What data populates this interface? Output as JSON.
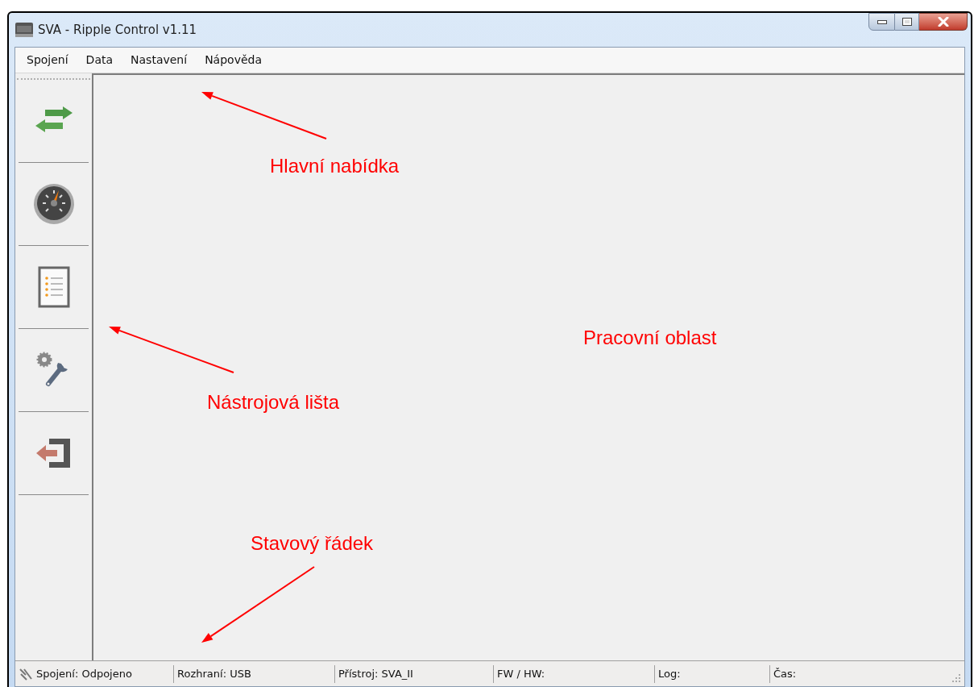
{
  "window": {
    "title": "SVA - Ripple Control v1.11"
  },
  "menu": [
    "Spojení",
    "Data",
    "Nastavení",
    "Nápověda"
  ],
  "toolbar": [
    {
      "kind": "connect"
    },
    {
      "kind": "gauge"
    },
    {
      "kind": "list"
    },
    {
      "kind": "tools"
    },
    {
      "kind": "exit"
    }
  ],
  "status_bar": [
    {
      "kind": "connection",
      "text": "Spojení: Odpojeno"
    },
    {
      "text": "Rozhraní: USB"
    },
    {
      "text": "Přístroj: SVA_II"
    },
    {
      "text": "FW / HW:"
    },
    {
      "text": "Log:"
    },
    {
      "text": "Čas:"
    }
  ],
  "annotations": [
    {
      "text": "Hlavní nabídka",
      "arrow": true
    },
    {
      "text": "Pracovní oblast",
      "arrow": false
    },
    {
      "text": "Nástrojová lišta",
      "arrow": true
    },
    {
      "text": "Stavový řádek",
      "arrow": true
    }
  ]
}
